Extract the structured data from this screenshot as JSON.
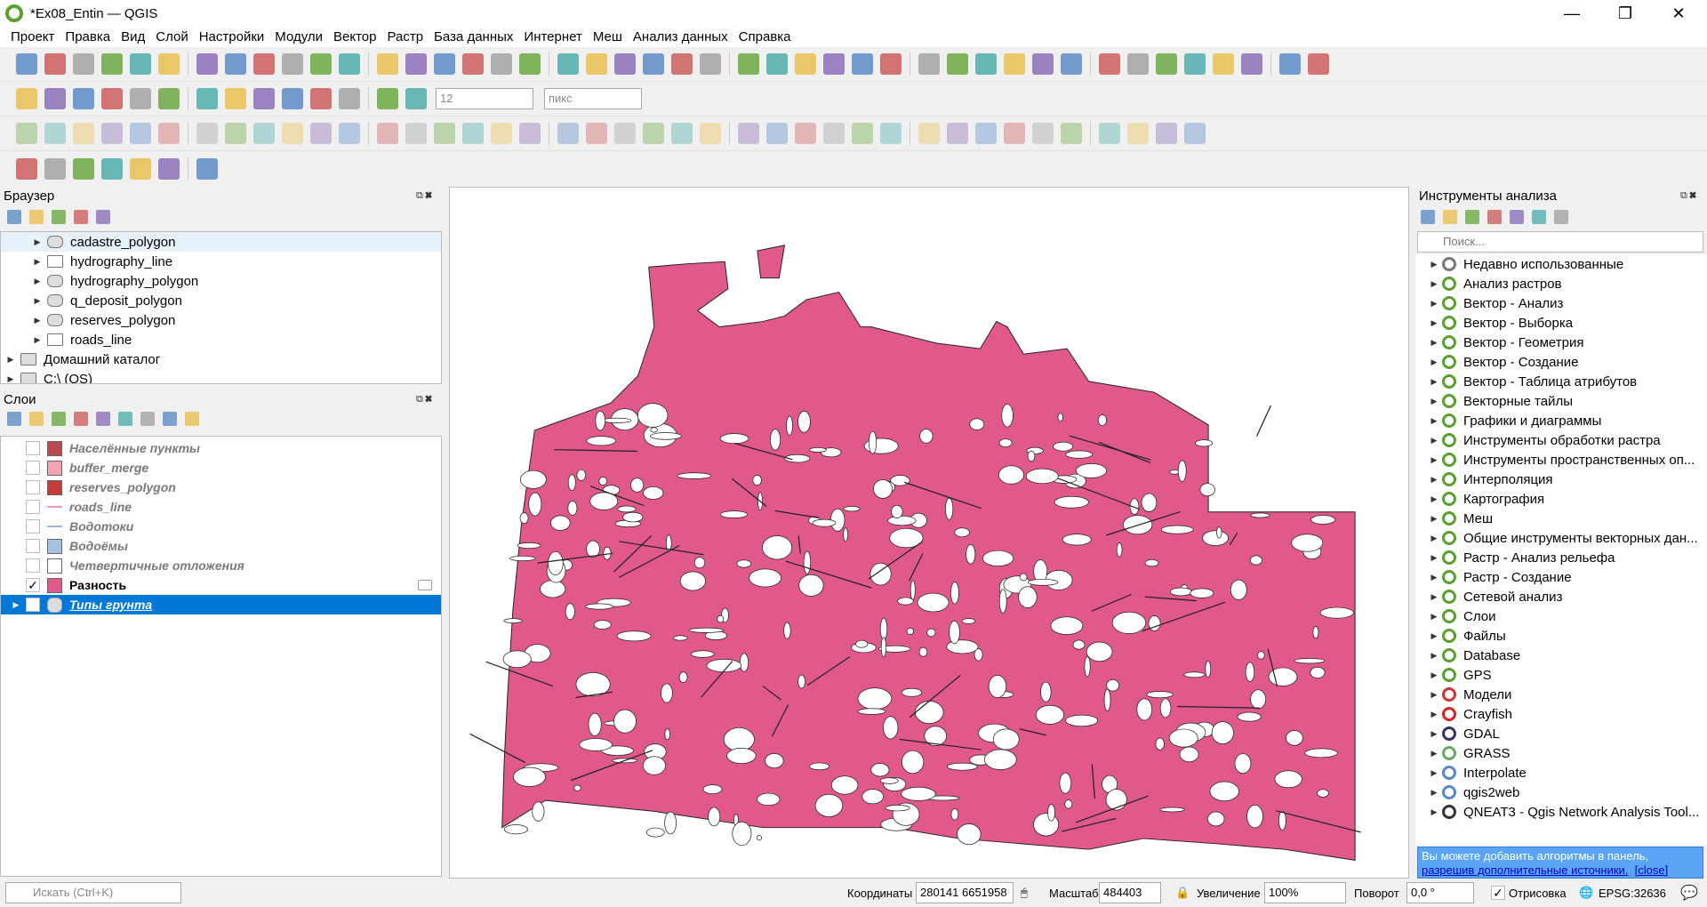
{
  "window": {
    "title": "*Ex08_Entin — QGIS",
    "minimize": "—",
    "maximize": "❐",
    "close": "✕"
  },
  "menu": [
    "Проект",
    "Правка",
    "Вид",
    "Слой",
    "Настройки",
    "Модули",
    "Вектор",
    "Растр",
    "База данных",
    "Интернет",
    "Меш",
    "Анализ данных",
    "Справка"
  ],
  "toolbar": {
    "size_value": "12",
    "unit_value": "пикс"
  },
  "browser": {
    "title": "Браузер",
    "items": [
      {
        "label": "cadastre_polygon",
        "type": "polygon",
        "indent": 1
      },
      {
        "label": "hydrography_line",
        "type": "line",
        "indent": 1
      },
      {
        "label": "hydrography_polygon",
        "type": "polygon",
        "indent": 1
      },
      {
        "label": "q_deposit_polygon",
        "type": "polygon",
        "indent": 1
      },
      {
        "label": "reserves_polygon",
        "type": "polygon",
        "indent": 1
      },
      {
        "label": "roads_line",
        "type": "line",
        "indent": 1
      },
      {
        "label": "Домашний каталог",
        "type": "home",
        "indent": 0
      },
      {
        "label": "C:\\ (OS)",
        "type": "folder",
        "indent": 0
      }
    ]
  },
  "layers": {
    "title": "Слои",
    "items": [
      {
        "label": "Населённые пункты",
        "checked": false,
        "swatch": "#b94a4e",
        "kind": "fill"
      },
      {
        "label": "buffer_merge",
        "checked": false,
        "swatch": "#f2a5b1",
        "kind": "fill"
      },
      {
        "label": "reserves_polygon",
        "checked": false,
        "swatch": "#c53a3a",
        "kind": "fill"
      },
      {
        "label": "roads_line",
        "checked": false,
        "swatch": "#f09ab0",
        "kind": "line"
      },
      {
        "label": "Водотоки",
        "checked": false,
        "swatch": "#9ab8e0",
        "kind": "line"
      },
      {
        "label": "Водоёмы",
        "checked": false,
        "swatch": "#a6c0e2",
        "kind": "fill"
      },
      {
        "label": "Четвертичные отложения",
        "checked": false,
        "swatch": "#ffffff",
        "kind": "fill"
      },
      {
        "label": "Разность",
        "checked": true,
        "swatch": "#e0598a",
        "kind": "fill"
      },
      {
        "label": "Типы грунта",
        "checked": false,
        "swatch": "#dddddd",
        "kind": "group"
      }
    ]
  },
  "map": {
    "fill_color": "#e0598a",
    "outline_color": "#222222"
  },
  "processing": {
    "title": "Инструменты анализа",
    "search_placeholder": "Поиск...",
    "items": [
      "Недавно использованные",
      "Анализ растров",
      "Вектор - Анализ",
      "Вектор - Выборка",
      "Вектор - Геометрия",
      "Вектор - Создание",
      "Вектор - Таблица атрибутов",
      "Векторные тайлы",
      "Графики и диаграммы",
      "Инструменты обработки растра",
      "Инструменты пространственных оп...",
      "Интерполяция",
      "Картография",
      "Меш",
      "Общие инструменты векторных дан...",
      "Растр - Анализ рельефа",
      "Растр - Создание",
      "Сетевой анализ",
      "Слои",
      "Файлы",
      "Database",
      "GPS",
      "Модели",
      "Crayfish",
      "GDAL",
      "GRASS",
      "Interpolate",
      "qgis2web",
      "QNEAT3 - Qgis Network Analysis Tool..."
    ],
    "notice_text": "Вы можете добавить алгоритмы в панель, ",
    "notice_link": "разрешив дополнительные источники.",
    "notice_close": "[close]"
  },
  "status": {
    "search_placeholder": "Искать (Ctrl+K)",
    "coords_label": "Координаты",
    "coords_value": "280141  6651958",
    "scale_label": "Масштаб",
    "scale_value": "484403",
    "zoom_label": "Увеличение",
    "zoom_value": "100%",
    "rotation_label": "Поворот",
    "rotation_value": "0,0 °",
    "render_label": "Отрисовка",
    "crs": "EPSG:32636"
  }
}
